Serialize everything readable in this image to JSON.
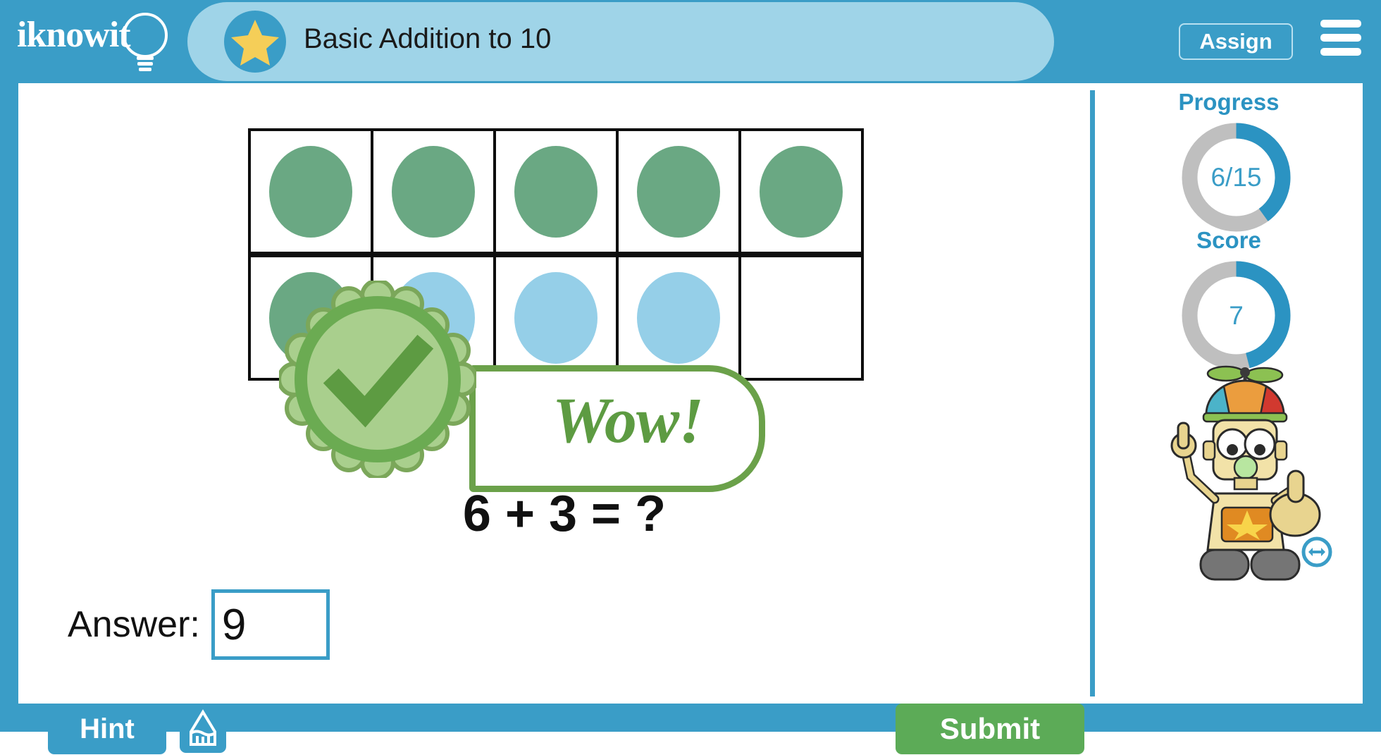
{
  "header": {
    "logo_text": "iknowit",
    "logo_icon": "lightbulb-icon",
    "lesson_title": "Basic Addition to 10",
    "star_icon": "star-icon",
    "assign_label": "Assign",
    "menu_icon": "hamburger-menu-icon",
    "bar_color": "#3a9dc7",
    "pill_color": "#9fd4e8"
  },
  "question": {
    "equation": "6 + 3 = ?",
    "ten_frame": {
      "rows": [
        [
          "green",
          "green",
          "green",
          "green",
          "green"
        ],
        [
          "green",
          "blue",
          "blue",
          "blue",
          "empty"
        ]
      ],
      "green_color": "#6aa883",
      "blue_color": "#95cfe8",
      "green_count": 6,
      "blue_count": 3
    }
  },
  "feedback": {
    "message": "Wow!",
    "seal_icon": "check-seal-icon",
    "accent_color": "#5d9b42"
  },
  "answer": {
    "label": "Answer:",
    "value": "9",
    "placeholder": ""
  },
  "actions": {
    "hint_label": "Hint",
    "scratchpad_icon": "pencil-icon",
    "submit_label": "Submit",
    "submit_color": "#5cab57"
  },
  "sidebar": {
    "progress": {
      "title": "Progress",
      "value": "6/15",
      "completed": 6,
      "total": 15,
      "percent": 40
    },
    "score": {
      "title": "Score",
      "value": "7",
      "percent": 46
    },
    "mascot_icon": "robot-mascot-icon",
    "resize_icon": "resize-horizontal-icon",
    "accent_color": "#2b93c2",
    "track_color": "#bfbfbf"
  }
}
